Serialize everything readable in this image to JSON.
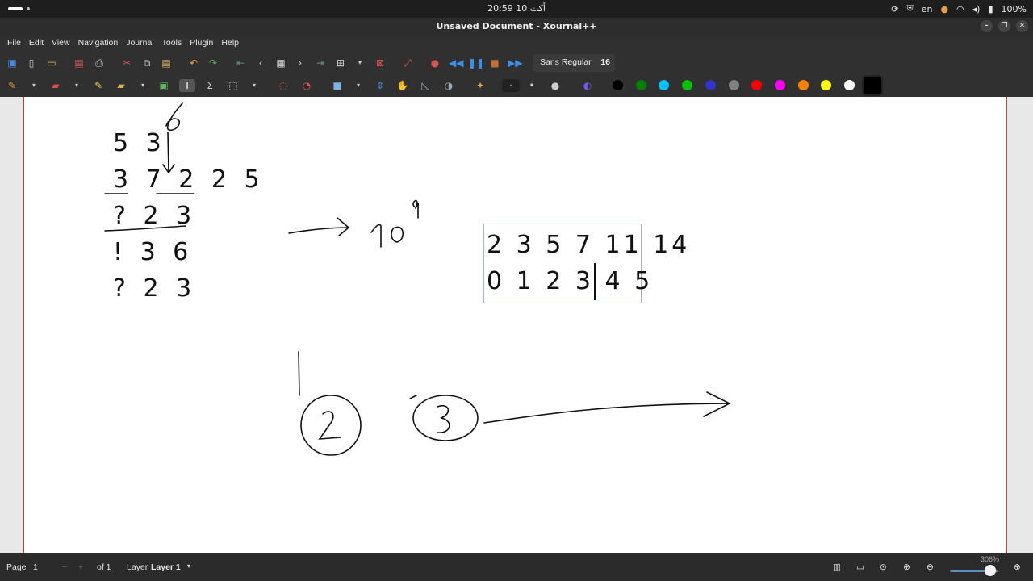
{
  "system_bar": {
    "clock": "20:59  أكت 10",
    "language": "en",
    "battery": "100%"
  },
  "window": {
    "title": "Unsaved Document - Xournal++",
    "minimize": "–",
    "maximize": "❐",
    "close": "✕"
  },
  "menu": [
    "File",
    "Edit",
    "View",
    "Navigation",
    "Journal",
    "Tools",
    "Plugin",
    "Help"
  ],
  "toolbar": {
    "font_name": "Sans Regular",
    "font_size": "16"
  },
  "palette": [
    "#000000",
    "#008000",
    "#00c0ff",
    "#00c000",
    "#3333cc",
    "#808080",
    "#ff0000",
    "#ff00ff",
    "#ff8000",
    "#ffff00",
    "#ffffff",
    "#000000"
  ],
  "canvas": {
    "left_column": [
      "5 3",
      "3 7 2 2 5",
      "? 2 3",
      "! 3 6",
      "? 2 3"
    ],
    "handwritten": {
      "six": "6",
      "ten": "10",
      "exp": "9",
      "circle_a": "2",
      "circle_b": "3"
    },
    "textbox": {
      "line1": "2 3 5 7 11 14",
      "line2": "0 1 2 3 4 5"
    }
  },
  "statusbar": {
    "page_label": "Page",
    "page_value": "1",
    "page_of": "of 1",
    "layer_label": "Layer",
    "layer_value": "Layer 1",
    "zoom": "306%"
  }
}
